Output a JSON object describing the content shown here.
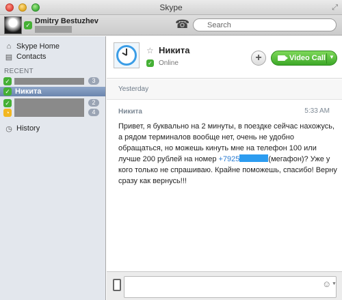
{
  "window": {
    "title": "Skype"
  },
  "profile": {
    "name": "Dmitry Bestuzhev",
    "status_glyph": "✓"
  },
  "search": {
    "placeholder": "Search"
  },
  "sidebar": {
    "home_label": "Skype Home",
    "contacts_label": "Contacts",
    "recent_label": "RECENT",
    "history_label": "History",
    "recent": [
      {
        "name": "",
        "status": "online",
        "badge": "3",
        "redacted": true
      },
      {
        "name": "Никита",
        "status": "online",
        "badge": "",
        "redacted": false,
        "selected": true
      },
      {
        "name": "",
        "status": "online",
        "badge": "2",
        "redacted": true
      },
      {
        "name": "",
        "status": "away",
        "badge": "4",
        "redacted": true
      }
    ]
  },
  "conversation": {
    "contact_name": "Никита",
    "contact_status": "Online",
    "video_call_label": "Video Call",
    "add_label": "+",
    "day_label": "Yesterday",
    "message": {
      "sender": "Никита",
      "time": "5:33 AM",
      "text_before": "Привет, я буквально на 2 минуты, в поездке сейчас нахожусь, а рядом терминалов вообще нет, очень не удобно обращаться, но можешь кинуть мне на телефон 100 или лучше 200 рублей на номер ",
      "phone_prefix": "+7925",
      "text_after": "(мегафон)? Уже у кого только не спрашиваю. Крайне поможешь, спасибо! Верну сразу как вернусь!!!"
    }
  },
  "colors": {
    "accent_green": "#45b035",
    "away_yellow": "#f2b721",
    "link_blue": "#2a7bd0",
    "selection": "#7a93ba"
  }
}
